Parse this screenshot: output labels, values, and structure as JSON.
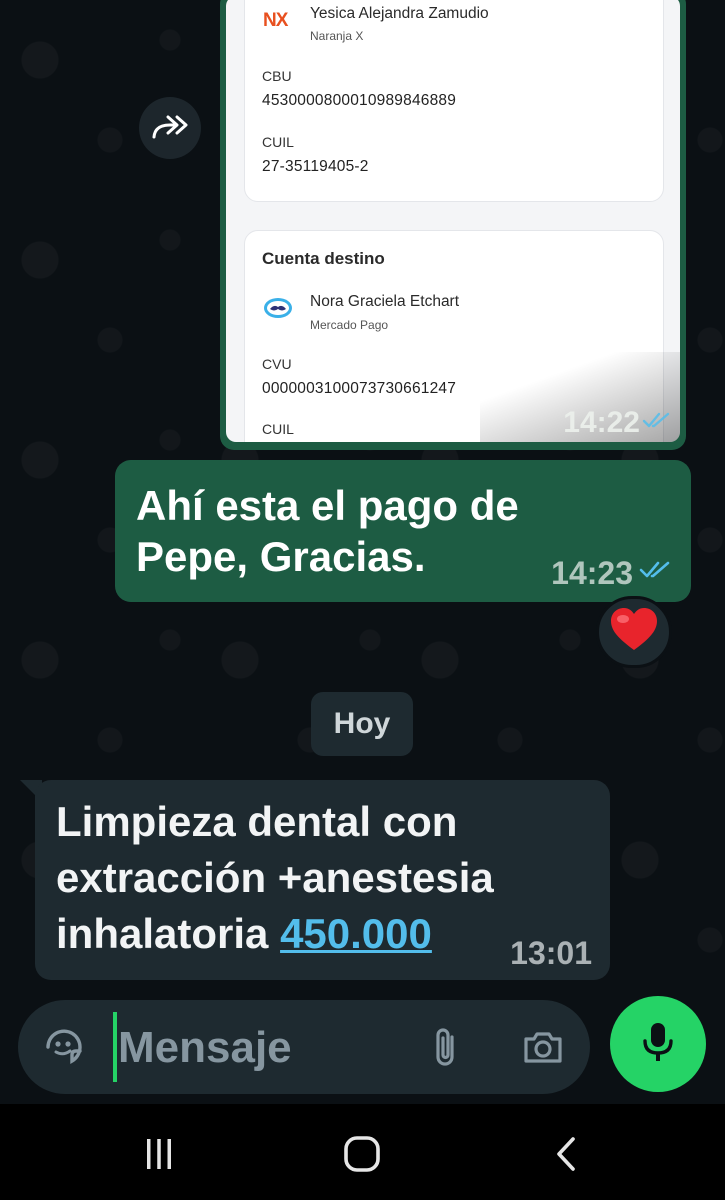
{
  "colors": {
    "outgoing_bubble": "#1d5c43",
    "incoming_bubble": "#1e2a30",
    "chat_background": "#0b1014",
    "accent_green": "#25d366",
    "link_blue": "#53bdeb",
    "read_ticks": "#53bdeb"
  },
  "forwarded_image": {
    "origin_card": {
      "account_name": "Yesica Alejandra Zamudio",
      "bank": "Naranja X",
      "bank_logo_text": "NX",
      "cbu_label": "CBU",
      "cbu": "4530000800010989846889",
      "cuil_label": "CUIL",
      "cuil": "27-35119405-2"
    },
    "dest_card": {
      "title": "Cuenta destino",
      "account_name": "Nora Graciela Etchart",
      "bank": "Mercado Pago",
      "cvu_label": "CVU",
      "cvu": "0000003100073730661247",
      "cuil_label": "CUIL"
    },
    "time": "14:22",
    "status_icon": "double-check-read-icon",
    "forward_icon": "forward-arrows-icon"
  },
  "outgoing_message": {
    "text": "Ahí esta el pago de Pepe, Gracias.",
    "time": "14:23",
    "status_icon": "double-check-read-icon",
    "reaction": "❤️"
  },
  "date_separator": "Hoy",
  "incoming_message": {
    "text": "Limpieza dental con extracción +anestesia inhalatoria ",
    "link": "450.000",
    "time": "13:01"
  },
  "composer": {
    "placeholder": "Mensaje",
    "emoji_icon": "sticker-icon",
    "attach_icon": "paperclip-icon",
    "camera_icon": "camera-icon",
    "mic_icon": "microphone-icon"
  },
  "navigation": {
    "recents_icon": "recents-icon",
    "home_icon": "home-icon",
    "back_icon": "back-icon"
  }
}
